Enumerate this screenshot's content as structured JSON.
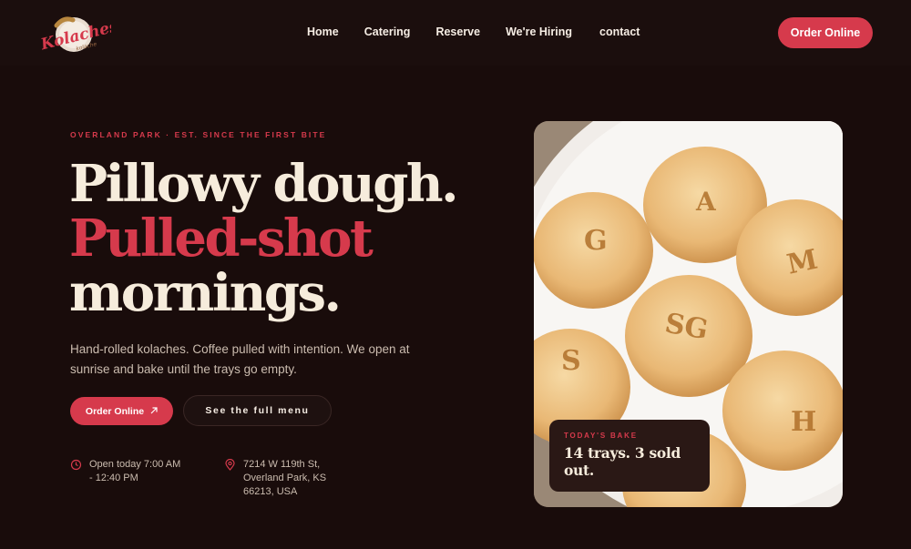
{
  "brand": {
    "logo_text": "Kolaches",
    "logo_sub": "kolache"
  },
  "nav": {
    "links": [
      "Home",
      "Catering",
      "Reserve",
      "We're Hiring",
      "contact"
    ],
    "cta": "Order Online"
  },
  "hero": {
    "eyebrow": "OVERLAND PARK · EST. SINCE THE FIRST BITE",
    "headline_line1": "Pillowy dough.",
    "headline_line2": "Pulled-shot",
    "headline_line3": "mornings.",
    "lede": "Hand-rolled kolaches. Coffee pulled with intention. We open at sunrise and bake until the trays go empty.",
    "primary_cta": "Order Online",
    "secondary_cta": "See the full menu",
    "hours": "Open today  7:00 AM\n- 12:40 PM",
    "address": "7214 W 119th St,\nOverland Park, KS\n66213, USA"
  },
  "photo": {
    "bun_letters": [
      "A",
      "G",
      "M",
      "SG",
      "S",
      "H"
    ]
  },
  "bake_card": {
    "label": "TODAY'S BAKE",
    "text": "14 trays. 3 sold out."
  },
  "colors": {
    "background": "#190c0b",
    "accent": "#d63a4c",
    "cream": "#f6ecdc"
  },
  "icons": {
    "hours": "clock-icon",
    "address": "location-pin-icon",
    "cta_arrow": "arrow-up-right-icon"
  }
}
